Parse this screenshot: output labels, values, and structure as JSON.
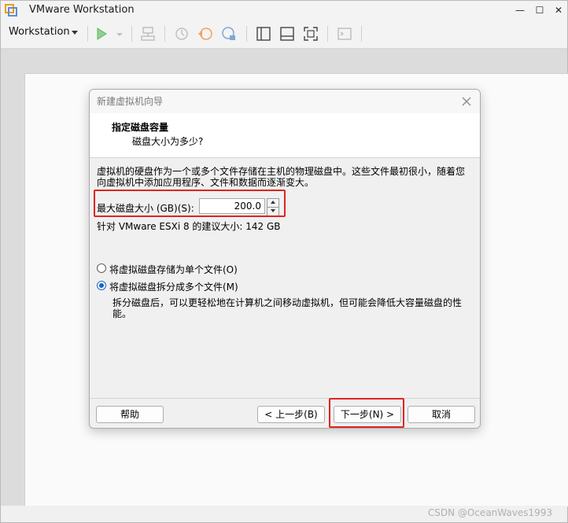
{
  "app": {
    "title": "VMware Workstation"
  },
  "toolbar": {
    "menu_label": "Workstation"
  },
  "dialog": {
    "title": "新建虚拟机向导",
    "header_title": "指定磁盘容量",
    "header_subtitle": "磁盘大小为多少?",
    "description": "虚拟机的硬盘作为一个或多个文件存储在主机的物理磁盘中。这些文件最初很小，随着您向虚拟机中添加应用程序、文件和数据而逐渐变大。",
    "disk_size_label": "最大磁盘大小 (GB)(S):",
    "disk_size_value": "200.0",
    "recommendation": "针对 VMware ESXi 8 的建议大小: 142 GB",
    "options": [
      {
        "label": "将虚拟磁盘存储为单个文件(O)",
        "selected": false
      },
      {
        "label": "将虚拟磁盘拆分成多个文件(M)",
        "selected": true
      }
    ],
    "split_description": "拆分磁盘后，可以更轻松地在计算机之间移动虚拟机，但可能会降低大容量磁盘的性能。",
    "buttons": {
      "help": "帮助",
      "back": "< 上一步(B)",
      "next": "下一步(N) >",
      "cancel": "取消"
    }
  },
  "watermark": "CSDN @OceanWaves1993",
  "colors": {
    "accent": "#1a64c8",
    "highlight": "#e0241f",
    "play": "#4caf50"
  }
}
